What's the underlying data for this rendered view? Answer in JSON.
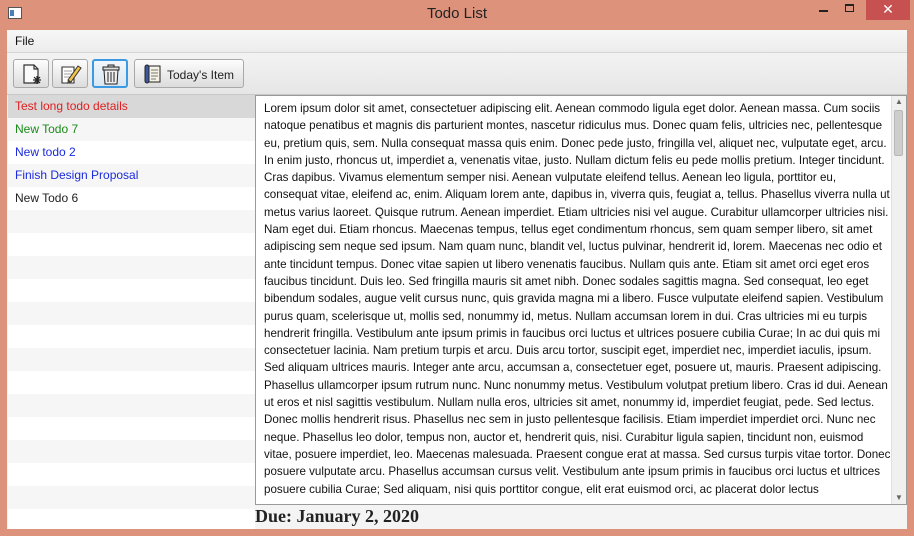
{
  "window": {
    "title": "Todo List",
    "close_glyph": "✕"
  },
  "menu": {
    "file_label": "File"
  },
  "toolbar": {
    "buttons": [
      {
        "icon": "new-document-icon"
      },
      {
        "icon": "edit-pencil-icon"
      },
      {
        "icon": "trash-can-icon"
      },
      {
        "icon": "scroll-icon",
        "label": "Today's Item"
      }
    ]
  },
  "todo_list": {
    "items": [
      {
        "label": "Test long todo details",
        "color": "#e02020"
      },
      {
        "label": "New Todo 7",
        "color": "#1a8a1a"
      },
      {
        "label": "New todo 2",
        "color": "#1a2adc"
      },
      {
        "label": "Finish Design Proposal",
        "color": "#1a2adc"
      },
      {
        "label": "New Todo 6",
        "color": "#222222"
      }
    ],
    "selected_index": 0
  },
  "details": {
    "text": "Lorem ipsum dolor sit amet, consectetuer adipiscing elit. Aenean commodo ligula eget dolor. Aenean massa. Cum sociis natoque penatibus et magnis dis parturient montes, nascetur ridiculus mus. Donec quam felis, ultricies nec, pellentesque eu, pretium quis, sem. Nulla consequat massa quis enim. Donec pede justo, fringilla vel, aliquet nec, vulputate eget, arcu. In enim justo, rhoncus ut, imperdiet a, venenatis vitae, justo. Nullam dictum felis eu pede mollis pretium. Integer tincidunt. Cras dapibus. Vivamus elementum semper nisi. Aenean vulputate eleifend tellus. Aenean leo ligula, porttitor eu, consequat vitae, eleifend ac, enim. Aliquam lorem ante, dapibus in, viverra quis, feugiat a, tellus. Phasellus viverra nulla ut metus varius laoreet. Quisque rutrum. Aenean imperdiet. Etiam ultricies nisi vel augue. Curabitur ullamcorper ultricies nisi. Nam eget dui. Etiam rhoncus. Maecenas tempus, tellus eget condimentum rhoncus, sem quam semper libero, sit amet adipiscing sem neque sed ipsum. Nam quam nunc, blandit vel, luctus pulvinar, hendrerit id, lorem. Maecenas nec odio et ante tincidunt tempus. Donec vitae sapien ut libero venenatis faucibus. Nullam quis ante. Etiam sit amet orci eget eros faucibus tincidunt. Duis leo. Sed fringilla mauris sit amet nibh. Donec sodales sagittis magna. Sed consequat, leo eget bibendum sodales, augue velit cursus nunc, quis gravida magna mi a libero. Fusce vulputate eleifend sapien. Vestibulum purus quam, scelerisque ut, mollis sed, nonummy id, metus. Nullam accumsan lorem in dui. Cras ultricies mi eu turpis hendrerit fringilla. Vestibulum ante ipsum primis in faucibus orci luctus et ultrices posuere cubilia Curae; In ac dui quis mi consectetuer lacinia. Nam pretium turpis et arcu. Duis arcu tortor, suscipit eget, imperdiet nec, imperdiet iaculis, ipsum. Sed aliquam ultrices mauris. Integer ante arcu, accumsan a, consectetuer eget, posuere ut, mauris. Praesent adipiscing. Phasellus ullamcorper ipsum rutrum nunc. Nunc nonummy metus. Vestibulum volutpat pretium libero. Cras id dui. Aenean ut eros et nisl sagittis vestibulum. Nullam nulla eros, ultricies sit amet, nonummy id, imperdiet feugiat, pede. Sed lectus. Donec mollis hendrerit risus. Phasellus nec sem in justo pellentesque facilisis. Etiam imperdiet imperdiet orci. Nunc nec neque. Phasellus leo dolor, tempus non, auctor et, hendrerit quis, nisi. Curabitur ligula sapien, tincidunt non, euismod vitae, posuere imperdiet, leo. Maecenas malesuada. Praesent congue erat at massa. Sed cursus turpis vitae tortor. Donec posuere vulputate arcu. Phasellus accumsan cursus velit. Vestibulum ante ipsum primis in faucibus orci luctus et ultrices posuere cubilia Curae; Sed aliquam, nisi quis porttitor congue, elit erat euismod orci, ac placerat dolor lectus",
    "due": "Due: January 2, 2020"
  }
}
